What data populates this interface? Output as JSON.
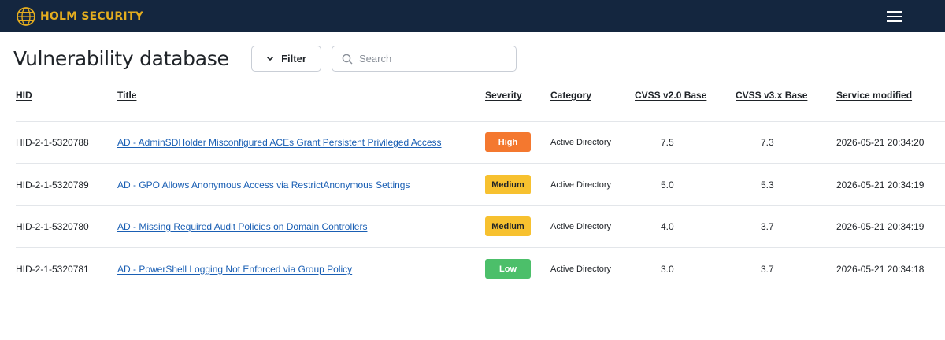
{
  "brand": {
    "name": "HOLM SECURITY",
    "logo_icon": "globe-lock-icon",
    "bar_color": "#14263f",
    "accent": "#e4ad1f"
  },
  "menu": {
    "icon": "hamburger-menu-icon"
  },
  "page": {
    "title": "Vulnerability database"
  },
  "toolbar": {
    "filter_label": "Filter",
    "filter_icon": "chevron-down-icon",
    "search_placeholder": "Search",
    "search_value": "",
    "search_icon": "search-icon"
  },
  "table": {
    "columns": [
      "HID",
      "Title",
      "Severity",
      "Category",
      "CVSS v2.0 Base",
      "CVSS v3.x Base",
      "Service modified"
    ],
    "rows": [
      {
        "hid": "HID-2-1-5320788",
        "title": "AD - AdminSDHolder Misconfigured ACEs Grant Persistent Privileged Access",
        "severity": "High",
        "severity_color": "#f4782f",
        "severity_text_color": "#ffffff",
        "category": "Active Directory",
        "cvss2": "7.5",
        "cvss3": "7.3",
        "modified": "2026-05-21 20:34:20"
      },
      {
        "hid": "HID-2-1-5320789",
        "title": "AD - GPO Allows Anonymous Access via RestrictAnonymous Settings",
        "severity": "Medium",
        "severity_color": "#f7c12f",
        "severity_text_color": "#1f2328",
        "category": "Active Directory",
        "cvss2": "5.0",
        "cvss3": "5.3",
        "modified": "2026-05-21 20:34:19"
      },
      {
        "hid": "HID-2-1-5320780",
        "title": "AD - Missing Required Audit Policies on Domain Controllers",
        "severity": "Medium",
        "severity_color": "#f7c12f",
        "severity_text_color": "#1f2328",
        "category": "Active Directory",
        "cvss2": "4.0",
        "cvss3": "3.7",
        "modified": "2026-05-21 20:34:19"
      },
      {
        "hid": "HID-2-1-5320781",
        "title": "AD - PowerShell Logging Not Enforced via Group Policy",
        "severity": "Low",
        "severity_color": "#4cbf6a",
        "severity_text_color": "#ffffff",
        "category": "Active Directory",
        "cvss2": "3.0",
        "cvss3": "3.7",
        "modified": "2026-05-21 20:34:18"
      }
    ]
  }
}
